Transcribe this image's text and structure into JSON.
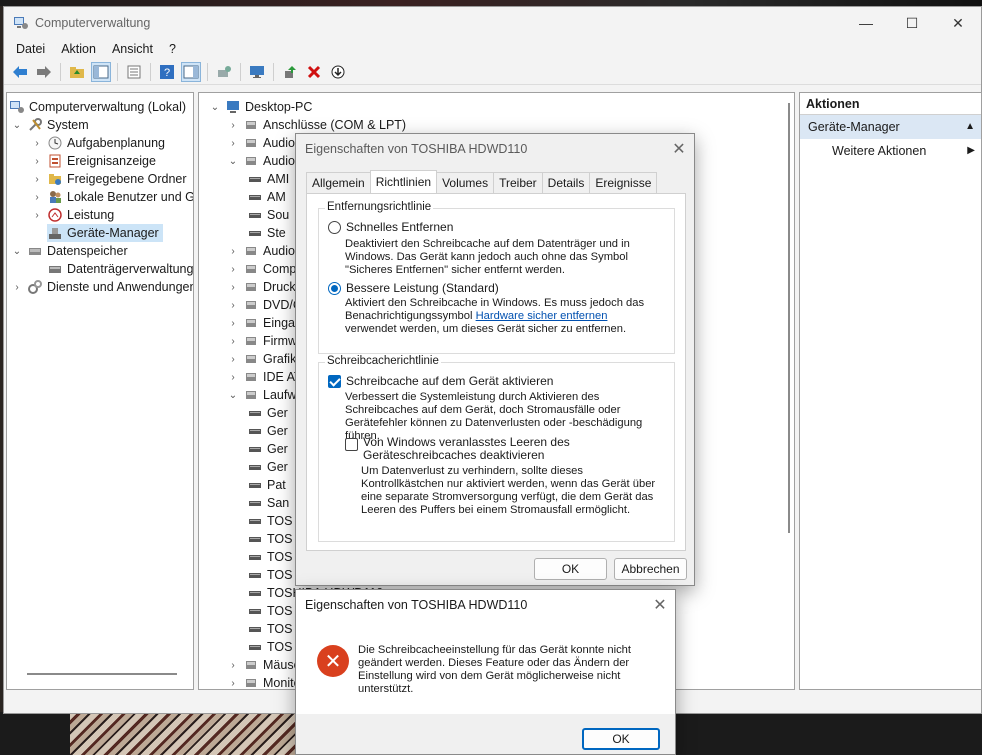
{
  "window": {
    "title": "Computerverwaltung",
    "controls": {
      "minimize": "—",
      "maximize": "☐",
      "close": "✕"
    }
  },
  "menu": [
    "Datei",
    "Aktion",
    "Ansicht",
    "?"
  ],
  "left_tree": [
    {
      "label": "Computerverwaltung (Lokal)",
      "chevron": "",
      "icon": "computer-management-icon"
    },
    {
      "label": "System",
      "chevron": "⌄",
      "icon": "tools-icon"
    },
    {
      "label": "Aufgabenplanung",
      "chevron": "›",
      "icon": "clock-icon"
    },
    {
      "label": "Ereignisanzeige",
      "chevron": "›",
      "icon": "event-viewer-icon"
    },
    {
      "label": "Freigegebene Ordner",
      "chevron": "›",
      "icon": "shared-folder-icon"
    },
    {
      "label": "Lokale Benutzer und Gru",
      "chevron": "›",
      "icon": "users-icon"
    },
    {
      "label": "Leistung",
      "chevron": "›",
      "icon": "performance-icon"
    },
    {
      "label": "Geräte-Manager",
      "chevron": "",
      "icon": "device-manager-icon"
    },
    {
      "label": "Datenspeicher",
      "chevron": "⌄",
      "icon": "storage-icon"
    },
    {
      "label": "Datenträgerverwaltung",
      "chevron": "",
      "icon": "disk-management-icon"
    },
    {
      "label": "Dienste und Anwendungen",
      "chevron": "›",
      "icon": "services-icon"
    }
  ],
  "device_tree": [
    {
      "label": "Desktop-PC",
      "chevron": "⌄"
    },
    {
      "label": "Anschlüsse (COM & LPT)",
      "chevron": "›"
    },
    {
      "label": "Audio",
      "chevron": "›"
    },
    {
      "label": "Audio,",
      "chevron": "⌄"
    },
    {
      "label": "AMI",
      "chevron": ""
    },
    {
      "label": "AM",
      "chevron": ""
    },
    {
      "label": "Sou",
      "chevron": ""
    },
    {
      "label": "Ste",
      "chevron": ""
    },
    {
      "label": "Audioe",
      "chevron": "›"
    },
    {
      "label": "Compu",
      "chevron": "›"
    },
    {
      "label": "Druckw",
      "chevron": "›"
    },
    {
      "label": "DVD/C",
      "chevron": "›"
    },
    {
      "label": "Eingab",
      "chevron": "›"
    },
    {
      "label": "Firmwa",
      "chevron": "›"
    },
    {
      "label": "Grafikk",
      "chevron": "›"
    },
    {
      "label": "IDE ATA",
      "chevron": "›"
    },
    {
      "label": "Laufwe",
      "chevron": "⌄"
    },
    {
      "label": "Ger",
      "chevron": ""
    },
    {
      "label": "Ger",
      "chevron": ""
    },
    {
      "label": "Ger",
      "chevron": ""
    },
    {
      "label": "Ger",
      "chevron": ""
    },
    {
      "label": "Pat",
      "chevron": ""
    },
    {
      "label": "San",
      "chevron": ""
    },
    {
      "label": "TOS",
      "chevron": ""
    },
    {
      "label": "TOS",
      "chevron": ""
    },
    {
      "label": "TOS",
      "chevron": ""
    },
    {
      "label": "TOS",
      "chevron": ""
    },
    {
      "label": "TOSHIBA HDWD110",
      "chevron": ""
    },
    {
      "label": "TOS",
      "chevron": ""
    },
    {
      "label": "TOS",
      "chevron": ""
    },
    {
      "label": "TOS",
      "chevron": ""
    },
    {
      "label": "Mäuse",
      "chevron": "›"
    },
    {
      "label": "Monito",
      "chevron": "›"
    }
  ],
  "actions": {
    "header": "Aktionen",
    "section": "Geräte-Manager",
    "section_arrow": "▲",
    "item": "Weitere Aktionen",
    "item_arrow": "▶"
  },
  "properties_dialog": {
    "title": "Eigenschaften von TOSHIBA HDWD110",
    "close": "✕",
    "tabs": [
      "Allgemein",
      "Richtlinien",
      "Volumes",
      "Treiber",
      "Details",
      "Ereignisse"
    ],
    "active_tab": "Richtlinien",
    "removal_group": "Entfernungsrichtlinie",
    "quick_removal": "Schnelles Entfernen",
    "quick_removal_desc": "Deaktiviert den Schreibcache auf dem Datenträger und in Windows. Das Gerät kann jedoch auch ohne das Symbol \"Sicheres Entfernen\" sicher entfernt werden.",
    "better_perf": "Bessere Leistung (Standard)",
    "better_perf_desc_1": "Aktiviert den Schreibcache in Windows. Es muss jedoch das Benachrichtigungssymbol",
    "better_perf_link": "Hardware sicher entfernen",
    "better_perf_desc_2": " verwendet werden, um dieses Gerät sicher zu entfernen.",
    "cache_group": "Schreibcacherichtlinie",
    "enable_cache": "Schreibcache auf dem Gerät aktivieren",
    "enable_cache_desc": "Verbessert die Systemleistung durch Aktivieren des Schreibcaches auf dem Gerät, doch Stromausfälle oder Gerätefehler können zu Datenverlusten oder -beschädigung führen.",
    "disable_flush": "Von Windows veranlasstes Leeren des Geräteschreibcaches deaktivieren",
    "disable_flush_desc": "Um Datenverlust zu verhindern, sollte dieses Kontrollkästchen nur aktiviert werden, wenn das Gerät über eine separate Stromversorgung verfügt, die dem Gerät das Leeren des Puffers bei einem Stromausfall ermöglicht.",
    "quick_removal_selected": false,
    "better_perf_selected": true,
    "enable_cache_checked": true,
    "disable_flush_checked": false,
    "ok": "OK",
    "cancel": "Abbrechen"
  },
  "error_dialog": {
    "title": "Eigenschaften von TOSHIBA HDWD110",
    "close": "✕",
    "icon": "✕",
    "message": "Die Schreibcacheeinstellung für das Gerät konnte nicht geändert werden. Dieses Feature oder das Ändern der Einstellung wird von dem Gerät möglicherweise nicht unterstützt.",
    "ok": "OK"
  }
}
